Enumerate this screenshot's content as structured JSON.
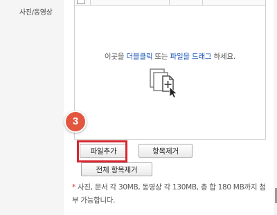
{
  "form": {
    "field_label": "사진/동영상"
  },
  "upload": {
    "drop_prefix": "이곳을 ",
    "drop_double_click": "더블클릭",
    "drop_or": " 또는 ",
    "drop_file_drag": "파일을 드래그",
    "drop_suffix": " 하세요.",
    "drop_icon": "files-add-cursor-icon"
  },
  "buttons": {
    "add_file": "파일추가",
    "remove_item": "항목제거",
    "remove_all": "전체 항목제거"
  },
  "annotation": {
    "step": "3",
    "color": "#d8262f"
  },
  "note": {
    "star": "*",
    "text": " 사진,   문서 각 30MB, 동영상 각 130MB, 총 합 180 MB까지 첨부 가능합니다."
  }
}
